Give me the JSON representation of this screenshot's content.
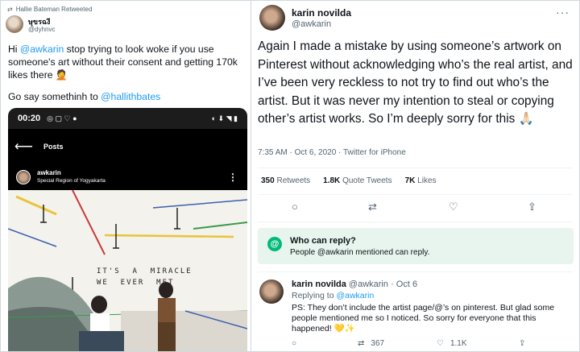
{
  "left_tweet": {
    "retweet_label": "Hallie Bateman Retweeted",
    "author_name": "ษุขรฉงี",
    "author_handle": "@dyhnvc",
    "text_hi": "Hi ",
    "mention_awkarin": "@awkarin",
    "text_body": " stop trying to look woke if you use someone's art without their consent and getting 170k likes there 🤦",
    "text_go": "Go say somethinh to ",
    "mention_hallie": "@hallithbates",
    "phone": {
      "time": "00:20",
      "nav_title": "Posts",
      "ig_username": "awkarin",
      "ig_location": "Special Region of Yogyakarta",
      "artwork_text": "IT'S  A  MIRACLE\nWE  EVER  MET"
    }
  },
  "right_tweet": {
    "author_name": "karin novilda",
    "author_handle": "@awkarin",
    "text": "Again I made a mistake by using someone’s artwork on Pinterest without acknowledging who’s the real artist, and I’ve been very reckless to not try to find out who’s the artist. But it was never my intention to steal or copying other’s artist works. So I’m deeply sorry for this 🙏🏻",
    "meta": "7:35 AM · Oct 6, 2020 · Twitter for iPhone",
    "retweets_count": "350",
    "retweets_label": "Retweets",
    "quotes_count": "1.8K",
    "quotes_label": "Quote Tweets",
    "likes_count": "7K",
    "likes_label": "Likes",
    "who_can_reply_title": "Who can reply?",
    "who_can_reply_desc": "People @awkarin mentioned can reply."
  },
  "reply_tweet": {
    "author_name": "karin novilda",
    "author_handle": "@awkarin",
    "date": "· Oct 6",
    "replying_prefix": "Replying to ",
    "replying_to": "@awkarin",
    "text": "PS: They don’t include the artist page/@’s on pinterest. But glad some people mentioned me so I noticed. So sorry for everyone that this happened! 💛✨",
    "retweets": "367",
    "likes": "1.1K"
  },
  "colors": {
    "link": "#1d9bf0",
    "muted": "#536471",
    "reply_box": "#e8f5ee",
    "reply_icon": "#00ba7c"
  },
  "icons": [
    "retweet-icon",
    "more-icon",
    "reply-icon",
    "share-icon",
    "like-icon",
    "at-icon",
    "back-arrow-icon"
  ]
}
